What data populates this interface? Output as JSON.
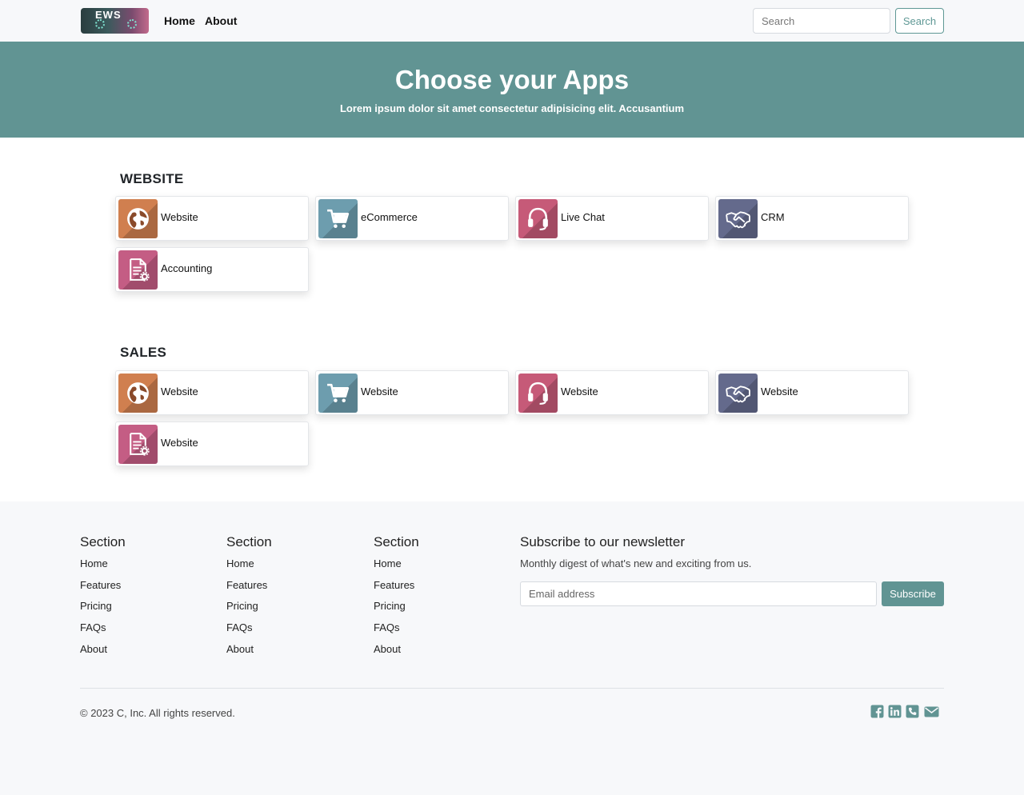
{
  "navbar": {
    "logo_text": "EWS",
    "links": [
      "Home",
      "About"
    ],
    "search_placeholder": "Search",
    "search_button": "Search"
  },
  "hero": {
    "title": "Choose your Apps",
    "subtitle": "Lorem ipsum dolor sit amet consectetur adipisicing elit. Accusantium"
  },
  "sections": [
    {
      "title": "WEBSITE",
      "apps": [
        {
          "label": "Website",
          "icon": "globe-icon"
        },
        {
          "label": "eCommerce",
          "icon": "cart-icon"
        },
        {
          "label": "Live Chat",
          "icon": "headset-icon"
        },
        {
          "label": "CRM",
          "icon": "handshake-icon"
        },
        {
          "label": "Accounting",
          "icon": "document-gear-icon"
        }
      ]
    },
    {
      "title": "SALES",
      "apps": [
        {
          "label": "Website",
          "icon": "globe-icon"
        },
        {
          "label": "Website",
          "icon": "cart-icon"
        },
        {
          "label": "Website",
          "icon": "headset-icon"
        },
        {
          "label": "Website",
          "icon": "handshake-icon"
        },
        {
          "label": "Website",
          "icon": "document-gear-icon"
        }
      ]
    }
  ],
  "footer": {
    "columns": [
      {
        "title": "Section",
        "links": [
          "Home",
          "Features",
          "Pricing",
          "FAQs",
          "About"
        ]
      },
      {
        "title": "Section",
        "links": [
          "Home",
          "Features",
          "Pricing",
          "FAQs",
          "About"
        ]
      },
      {
        "title": "Section",
        "links": [
          "Home",
          "Features",
          "Pricing",
          "FAQs",
          "About"
        ]
      }
    ],
    "newsletter": {
      "title": "Subscribe to our newsletter",
      "description": "Monthly digest of what's new and exciting from us.",
      "email_placeholder": "Email address",
      "button": "Subscribe"
    },
    "copyright": "© 2023 C, Inc. All rights reserved.",
    "social_icons": [
      "facebook-icon",
      "linkedin-icon",
      "phone-icon",
      "email-icon"
    ]
  },
  "colors": {
    "accent": "#619493",
    "footer_bg": "#f7f8fa",
    "globe": "#d07f4f",
    "cart": "#6d9dae",
    "headset": "#c65a78",
    "handshake": "#646a8c",
    "document": "#c45d84"
  }
}
